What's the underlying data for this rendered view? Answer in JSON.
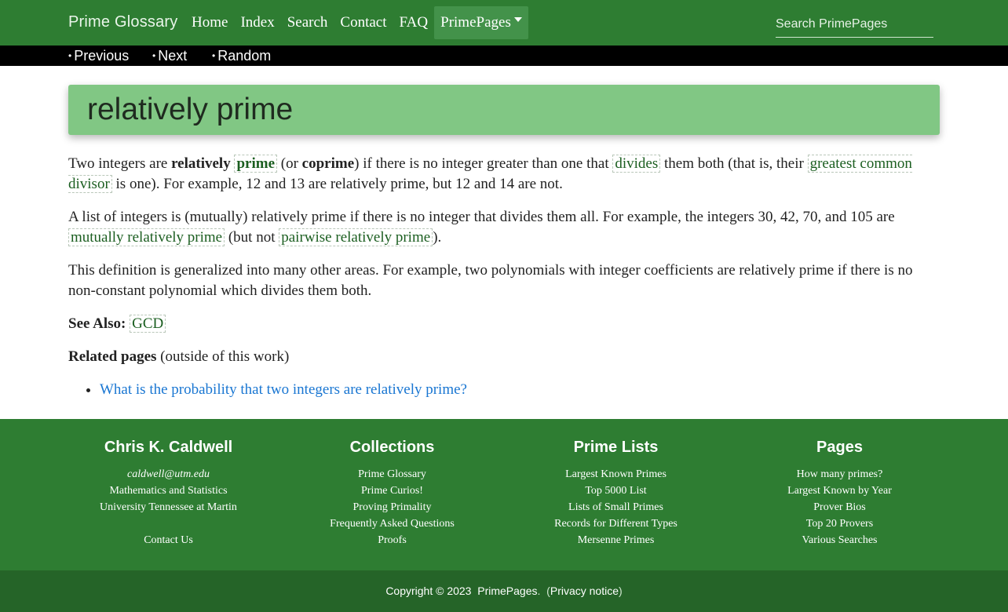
{
  "navbar": {
    "brand": "Prime Glossary",
    "links": [
      "Home",
      "Index",
      "Search",
      "Contact",
      "FAQ"
    ],
    "dropdown_label": "PrimePages",
    "search_placeholder": "Search PrimePages"
  },
  "subnav": {
    "bullet": "•",
    "previous": "Previous",
    "next": "Next",
    "random": "Random"
  },
  "title": "relatively prime",
  "content": {
    "p1": {
      "t1": "Two integers are ",
      "relatively": "relatively",
      "prime_link": "prime",
      "t2": " (or ",
      "coprime": "coprime",
      "t3": ") if there is no integer greater than one that ",
      "divides_link": "divides",
      "t4": " them both (that is, their ",
      "gcd_link": "greatest common divisor",
      "t5": " is one). For example, 12 and 13 are relatively prime, but 12 and 14 are not."
    },
    "p2": {
      "t1": "A list of integers is (mutually) relatively prime if there is no integer that divides them all. For example, the integers 30, 42, 70, and 105 are ",
      "mutually_link": "mutually relatively prime",
      "t2": " (but not ",
      "pairwise_link": "pairwise relatively prime",
      "t3": ")."
    },
    "p3": "This definition is generalized into many other areas. For example, two polynomials with integer coefficients are relatively prime if there is no non-constant polynomial which divides them both.",
    "see_also_label": "See Also:",
    "see_also_link": "GCD",
    "related_label": "Related pages",
    "related_suffix": " (outside of this work)",
    "related_items": [
      "What is the probability that two integers are relatively prime?"
    ]
  },
  "footer": {
    "col1": {
      "title": "Chris K. Caldwell",
      "email": "caldwell@utm.edu",
      "line2": "Mathematics and Statistics",
      "line3": "University Tennessee at Martin",
      "contact": "Contact Us"
    },
    "col2": {
      "title": "Collections",
      "items": [
        "Prime Glossary",
        "Prime Curios!",
        "Proving Primality",
        "Frequently Asked Questions",
        "Proofs"
      ]
    },
    "col3": {
      "title": "Prime Lists",
      "items": [
        "Largest Known Primes",
        "Top 5000 List",
        "Lists of Small Primes",
        "Records for Different Types",
        "Mersenne Primes"
      ]
    },
    "col4": {
      "title": "Pages",
      "items": [
        "How many primes?",
        "Largest Known by Year",
        "Prover Bios",
        "Top 20 Provers",
        "Various Searches"
      ]
    }
  },
  "copyright": {
    "text": "Copyright © 2023",
    "site": "PrimePages",
    "privacy": "Privacy notice"
  }
}
